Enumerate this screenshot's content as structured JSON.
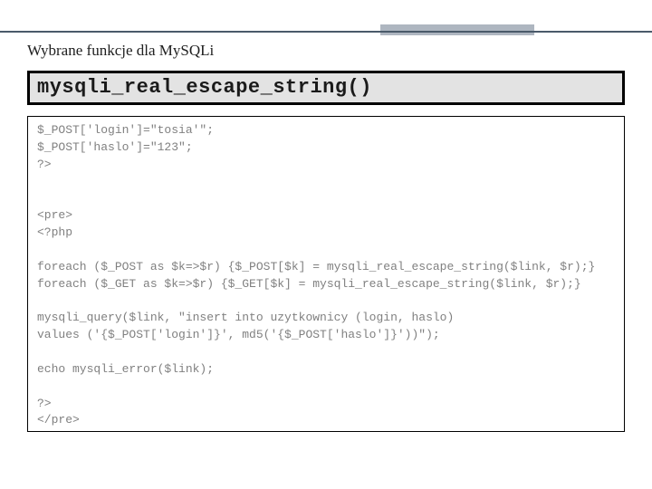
{
  "header": {
    "title": "Wybrane funkcje dla MySQLi"
  },
  "function_box": {
    "name": "mysqli_real_escape_string()"
  },
  "code": {
    "body": "$_POST['login']=\"tosia'\";\n$_POST['haslo']=\"123\";\n?>\n\n\n<pre>\n<?php\n\nforeach ($_POST as $k=>$r) {$_POST[$k] = mysqli_real_escape_string($link, $r);}\nforeach ($_GET as $k=>$r) {$_GET[$k] = mysqli_real_escape_string($link, $r);}\n\nmysqli_query($link, \"insert into uzytkownicy (login, haslo)\nvalues ('{$_POST['login']}', md5('{$_POST['haslo']}'))\");\n\necho mysqli_error($link);\n\n?>\n</pre>"
  }
}
